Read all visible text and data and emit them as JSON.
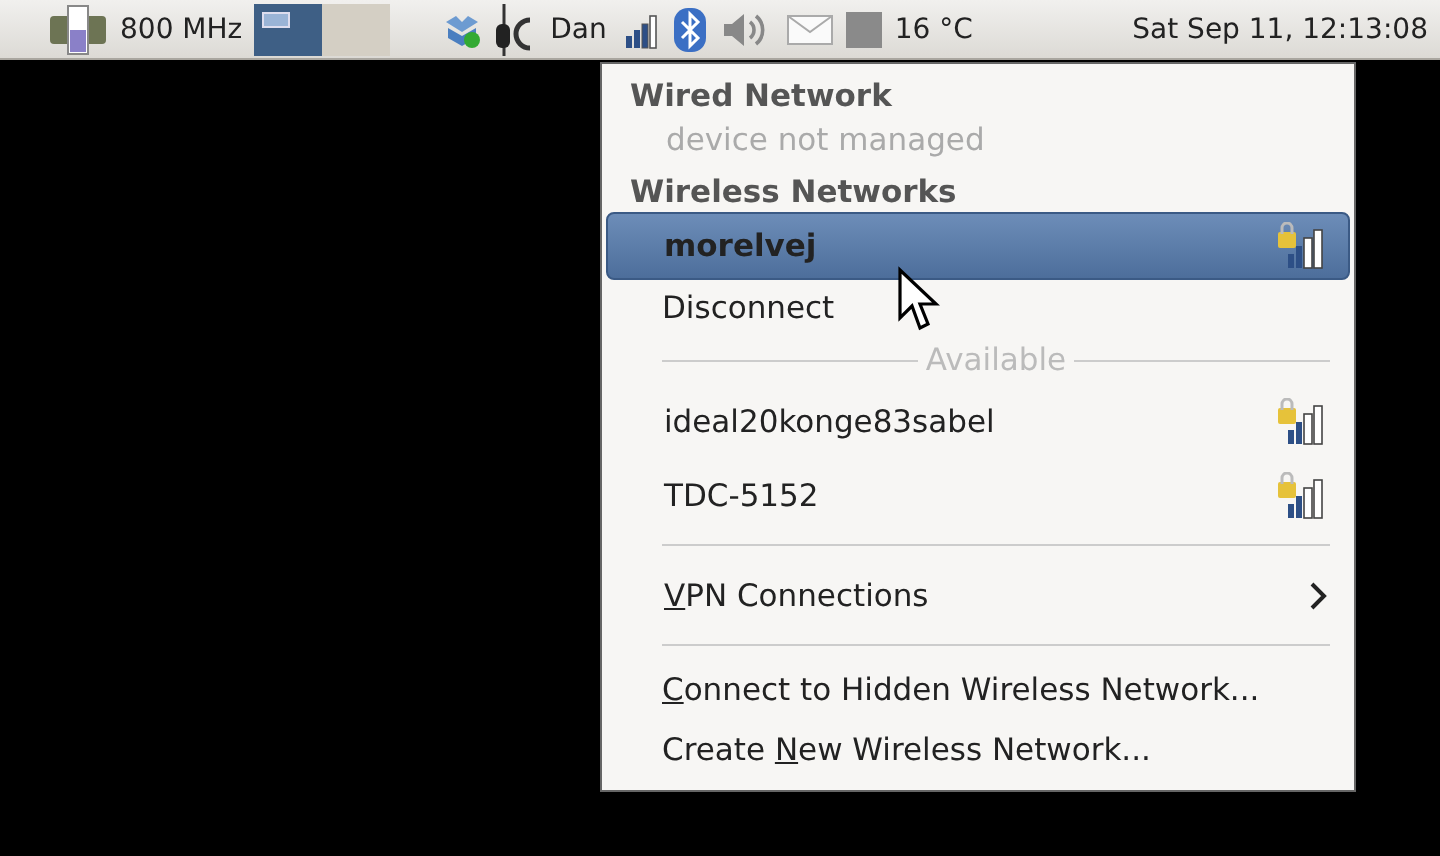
{
  "panel": {
    "cpu_frequency": "800 MHz",
    "workspaces": [
      {
        "selected": true
      },
      {
        "selected": false
      }
    ],
    "user": "Dan",
    "temperature": "16 °C",
    "clock": "Sat Sep 11, 12:13:08"
  },
  "menu": {
    "items": [
      {
        "kind": "header",
        "label": "Wired Network"
      },
      {
        "kind": "disabled",
        "label": "device not managed"
      },
      {
        "kind": "header",
        "label": "Wireless Networks"
      },
      {
        "kind": "network",
        "label": "morelvej",
        "selected": true,
        "connected": true
      },
      {
        "kind": "action",
        "label": "Disconnect"
      },
      {
        "kind": "labeled-separator",
        "label": "Available"
      },
      {
        "kind": "network",
        "label": "ideal20konge83sabel",
        "selected": false,
        "connected": false
      },
      {
        "kind": "network",
        "label": "TDC-5152",
        "selected": false,
        "connected": false
      },
      {
        "kind": "separator"
      },
      {
        "kind": "submenu",
        "label_parts": [
          {
            "text": "V",
            "underlined": true
          },
          {
            "text": "PN Connections",
            "underlined": false
          }
        ]
      },
      {
        "kind": "separator"
      },
      {
        "kind": "action",
        "label_parts": [
          {
            "text": "C",
            "underlined": true
          },
          {
            "text": "onnect to Hidden Wireless Network...",
            "underlined": false
          }
        ]
      },
      {
        "kind": "action",
        "label_parts": [
          {
            "text": "Create ",
            "underlined": false
          },
          {
            "text": "N",
            "underlined": true
          },
          {
            "text": "ew Wireless Network...",
            "underlined": false
          }
        ]
      }
    ]
  }
}
